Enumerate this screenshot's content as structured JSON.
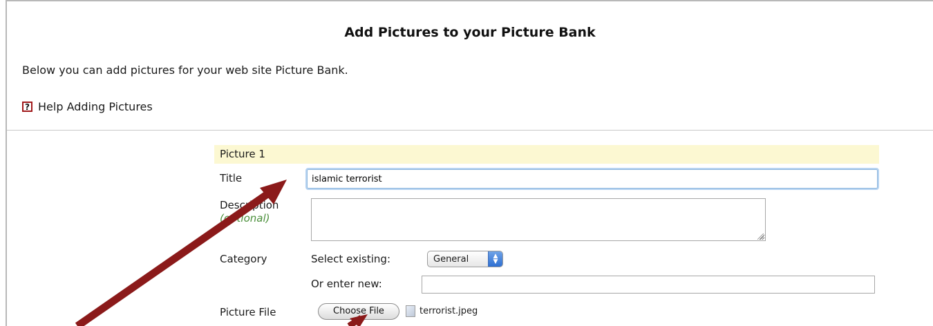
{
  "page": {
    "title": "Add Pictures to your Picture Bank",
    "intro": "Below you can add pictures for your web site Picture Bank.",
    "help_icon_glyph": "?",
    "help_link": "Help Adding Pictures"
  },
  "picture": {
    "header": "Picture 1",
    "title_label": "Title",
    "title_value": "islamic terrorist",
    "description_label": "Description",
    "description_optional": "(optional)",
    "description_value": "",
    "category_label": "Category",
    "select_existing_label": "Select existing:",
    "select_value": "General",
    "enter_new_label": "Or enter new:",
    "new_category_value": "",
    "file_label": "Picture File",
    "choose_file_button": "Choose File",
    "file_name": "terrorist.jpeg"
  },
  "icons": {
    "help": "help-question-icon",
    "select_arrows": "up-down-arrows-icon",
    "file": "file-icon"
  },
  "colors": {
    "annotation_arrow": "#8b1a1a",
    "optional_text": "#4a8f3a",
    "picture_header_bg": "#fcf8d2",
    "help_icon_border": "#a0191b"
  }
}
